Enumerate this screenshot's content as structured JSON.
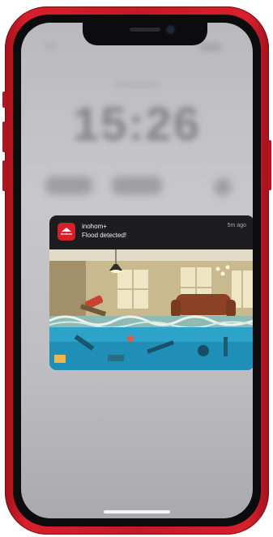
{
  "notification": {
    "app_name": "inohom+",
    "time_ago": "5m ago",
    "message": "Flood detected!",
    "icon_text": "inohom",
    "brand_color": "#d61f26",
    "image": "flooded living room with sofa and furniture underwater"
  },
  "lockscreen": {
    "clock": "15:26"
  }
}
